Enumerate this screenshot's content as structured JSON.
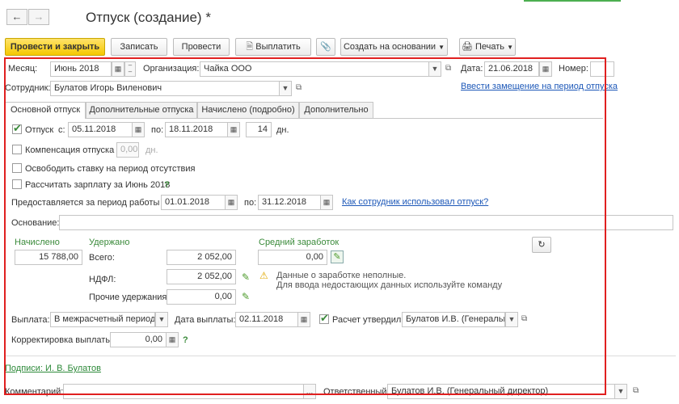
{
  "window": {
    "title": "Отпуск (создание) *"
  },
  "toolbar": {
    "post_close": "Провести и закрыть",
    "save": "Записать",
    "post": "Провести",
    "pay": "Выплатить",
    "create_based": "Создать на основании",
    "print": "Печать"
  },
  "header": {
    "month_label": "Месяц:",
    "month_value": "Июнь 2018",
    "org_label": "Организация:",
    "org_value": "Чайка ООО",
    "date_label": "Дата:",
    "date_value": "21.06.2018",
    "number_label": "Номер:",
    "number_value": "",
    "employee_label": "Сотрудник:",
    "employee_value": "Булатов Игорь Виленович",
    "substitution_link": "Ввести замещение на период отпуска"
  },
  "tabs": [
    "Основной отпуск",
    "Дополнительные отпуска",
    "Начислено (подробно)",
    "Дополнительно"
  ],
  "main": {
    "vacation_label": "Отпуск",
    "from_label": "с:",
    "vacation_from": "05.11.2018",
    "to_label": "по:",
    "vacation_to": "18.11.2018",
    "days_value": "14",
    "days_unit": "дн.",
    "compensation_label": "Компенсация отпуска",
    "compensation_value": "0,00",
    "compensation_unit": "дн.",
    "release_rate_label": "Освободить ставку на период отсутствия",
    "calc_salary_label": "Рассчитать зарплату за Июнь 2018",
    "help_mark": "?",
    "period_label": "Предоставляется за период работы с:",
    "period_from": "01.01.2018",
    "period_to_label": "по:",
    "period_to": "31.12.2018",
    "used_link": "Как сотрудник использовал отпуск?",
    "basis_label": "Основание:",
    "basis_value": ""
  },
  "amounts": {
    "accrued_label": "Начислено",
    "accrued_value": "15 788,00",
    "withheld_label": "Удержано",
    "total_label": "Всего:",
    "total_value": "2 052,00",
    "ndfl_label": "НДФЛ:",
    "ndfl_value": "2 052,00",
    "other_label": "Прочие удержания:",
    "other_value": "0,00",
    "avg_label": "Средний заработок",
    "avg_value": "0,00",
    "warn_line1": "Данные о заработке неполные.",
    "warn_line2": "Для ввода недостающих данных используйте команду"
  },
  "payment": {
    "payout_label": "Выплата:",
    "payout_value": "В межрасчетный период",
    "pay_date_label": "Дата выплаты:",
    "pay_date_value": "02.11.2018",
    "approved_label": "Расчет утвердил",
    "approved_value": "Булатов И.В. (Генеральнь",
    "correction_label": "Корректировка выплаты:",
    "correction_value": "0,00",
    "help_mark": "?"
  },
  "footer": {
    "signatures_link": "Подписи: И. В. Булатов",
    "comment_label": "Комментарий:",
    "comment_value": "",
    "responsible_label": "Ответственный:",
    "responsible_value": "Булатов И.В. (Генеральный директор)"
  },
  "colors": {
    "primary_button": "#f5c800",
    "accent_green": "#3a8a3a",
    "link_blue": "#1d58b8",
    "highlight_red": "#e02020"
  }
}
